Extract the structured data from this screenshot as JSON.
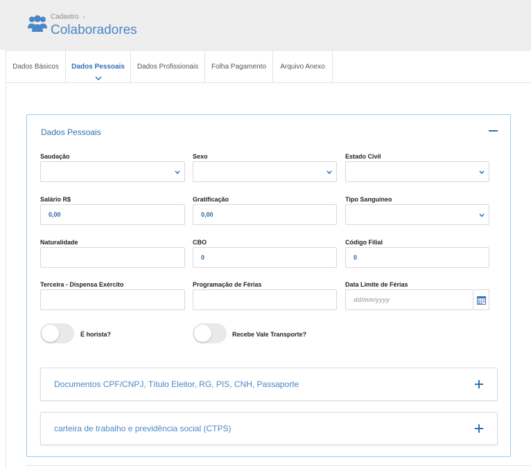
{
  "header": {
    "breadcrumb": "Cadastro",
    "breadcrumb_sep": "›",
    "title": "Colaboradores",
    "icon": "users-icon"
  },
  "tabs": [
    {
      "label": "Dados Básicos",
      "active": false
    },
    {
      "label": "Dados Pessoais",
      "active": true
    },
    {
      "label": "Dados Profissionais",
      "active": false
    },
    {
      "label": "Folha Pagamento",
      "active": false
    },
    {
      "label": "Arquivo Anexo",
      "active": false
    }
  ],
  "panel": {
    "title": "Dados Pessoais",
    "fields": {
      "saudacao": {
        "label": "Saudação",
        "value": ""
      },
      "sexo": {
        "label": "Sexo",
        "value": ""
      },
      "estado_civil": {
        "label": "Estado Civil",
        "value": ""
      },
      "salario": {
        "label": "Salário R$",
        "value": "0,00"
      },
      "gratificacao": {
        "label": "Gratificação",
        "value": "0,00"
      },
      "tipo_sanguineo": {
        "label": "Tipo Sanguíneo",
        "value": ""
      },
      "naturalidade": {
        "label": "Naturalidade",
        "value": ""
      },
      "cbo": {
        "label": "CBO",
        "value": "0"
      },
      "codigo_filial": {
        "label": "Código Filial",
        "value": "0"
      },
      "terceira": {
        "label": "Terceira - Dispensa Exército",
        "value": ""
      },
      "programacao_ferias": {
        "label": "Programação de Férias",
        "value": ""
      },
      "data_limite_ferias": {
        "label": "Data Limite de Férias",
        "placeholder": "dd/mm/yyyy"
      }
    },
    "toggles": {
      "horista": {
        "label": "É horista?",
        "on": false
      },
      "vale_transporte": {
        "label": "Recebe Vale Transporte?",
        "on": false
      }
    },
    "accordions": [
      {
        "title": "Documentos CPF/CNPJ, Título Eleitor, RG, PIS, CNH, Passaporte"
      },
      {
        "title": "carteira de trabalho e previdência social (CTPS)"
      }
    ]
  },
  "colors": {
    "accent": "#2f6fb3",
    "title_blue": "#4a86c8",
    "panel_border": "#9cc9e8",
    "header_bg": "#eeeeee"
  }
}
